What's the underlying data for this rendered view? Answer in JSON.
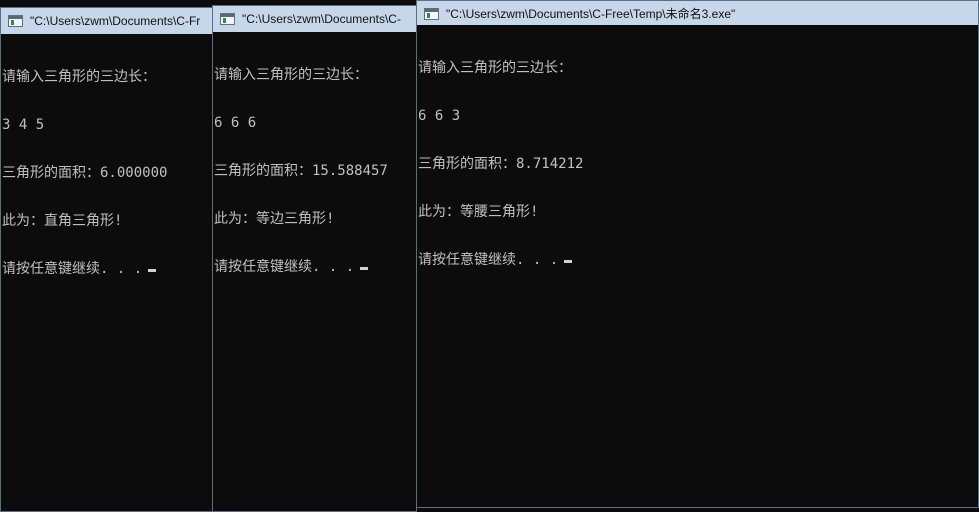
{
  "windows": [
    {
      "title": "\"C:\\Users\\zwm\\Documents\\C-Fr",
      "prompt": "请输入三角形的三边长：",
      "input": "3 4 5",
      "area_line": "三角形的面积：6.000000",
      "type_line": "此为：直角三角形!",
      "continue_line": "请按任意键继续. . ."
    },
    {
      "title": "\"C:\\Users\\zwm\\Documents\\C-",
      "prompt": "请输入三角形的三边长：",
      "input": "6 6 6",
      "area_line": "三角形的面积：15.588457",
      "type_line": "此为：等边三角形!",
      "continue_line": "请按任意键继续. . ."
    },
    {
      "title": "\"C:\\Users\\zwm\\Documents\\C-Free\\Temp\\未命名3.exe\"",
      "prompt": "请输入三角形的三边长：",
      "input": "6 6 3",
      "area_line": "三角形的面积：8.714212",
      "type_line": "此为：等腰三角形!",
      "continue_line": "请按任意键继续. . ."
    }
  ],
  "colors": {
    "console_background": "#0c0c0c",
    "console_text": "#c0c0c0",
    "titlebar_background": "#c7d7ea"
  },
  "icons": {
    "window_icon": "console-window-icon",
    "cursor": "text-cursor"
  }
}
